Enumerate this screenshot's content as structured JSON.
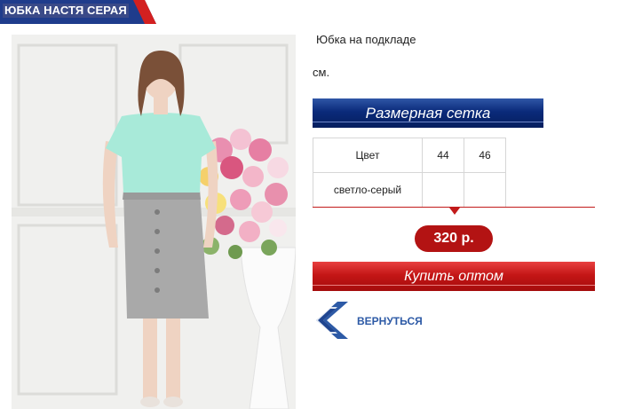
{
  "product": {
    "title": "ЮБКА НАСТЯ СЕРАЯ",
    "description": "Юбка на подкладе",
    "unit": "см."
  },
  "size_chart": {
    "label": "Размерная сетка",
    "headers": [
      "Цвет",
      "44",
      "46"
    ],
    "rows": [
      [
        "светло-серый",
        "",
        ""
      ]
    ]
  },
  "price": "320 р.",
  "buy_label": "Купить оптом",
  "back_label": "ВЕРНУТЬСЯ",
  "colors": {
    "accent_red": "#c21a1a",
    "accent_blue": "#0a2a7a"
  },
  "icons": {
    "back": "double-chevron-left-icon"
  }
}
